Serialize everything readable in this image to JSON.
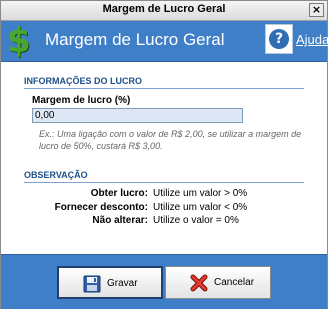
{
  "window": {
    "title": "Margem de Lucro Geral",
    "close_glyph": "×"
  },
  "header": {
    "icon": "dollar-icon",
    "dollar_glyph": "$",
    "title": "Margem de Lucro Geral",
    "help_icon": "question-icon",
    "help_glyph": "?",
    "help_label": "Ajuda"
  },
  "profit_section": {
    "title": "INFORMAÇÕES DO LUCRO",
    "field_label": "Margem de lucro (%)",
    "field_value": "0,00",
    "example": "Ex.: Uma ligação com o valor de R$ 2,00, se utilizar a margem de lucro de 50%, custará R$ 3,00."
  },
  "observation_section": {
    "title": "OBSERVAÇÃO",
    "rows": [
      {
        "label": "Obter lucro:",
        "value": "Utilize um valor > 0%"
      },
      {
        "label": "Fornecer desconto:",
        "value": "Utilize um valor < 0%"
      },
      {
        "label": "Não alterar:",
        "value": "Utilize o valor = 0%"
      }
    ]
  },
  "footer": {
    "save_label": "Gravar",
    "save_icon": "floppy-disk-icon",
    "cancel_label": "Cancelar",
    "cancel_icon": "red-x-icon"
  },
  "colors": {
    "header_blue": "#3f7fc8",
    "section_title": "#1f4f8a",
    "dollar_green": "#4aa72e"
  }
}
